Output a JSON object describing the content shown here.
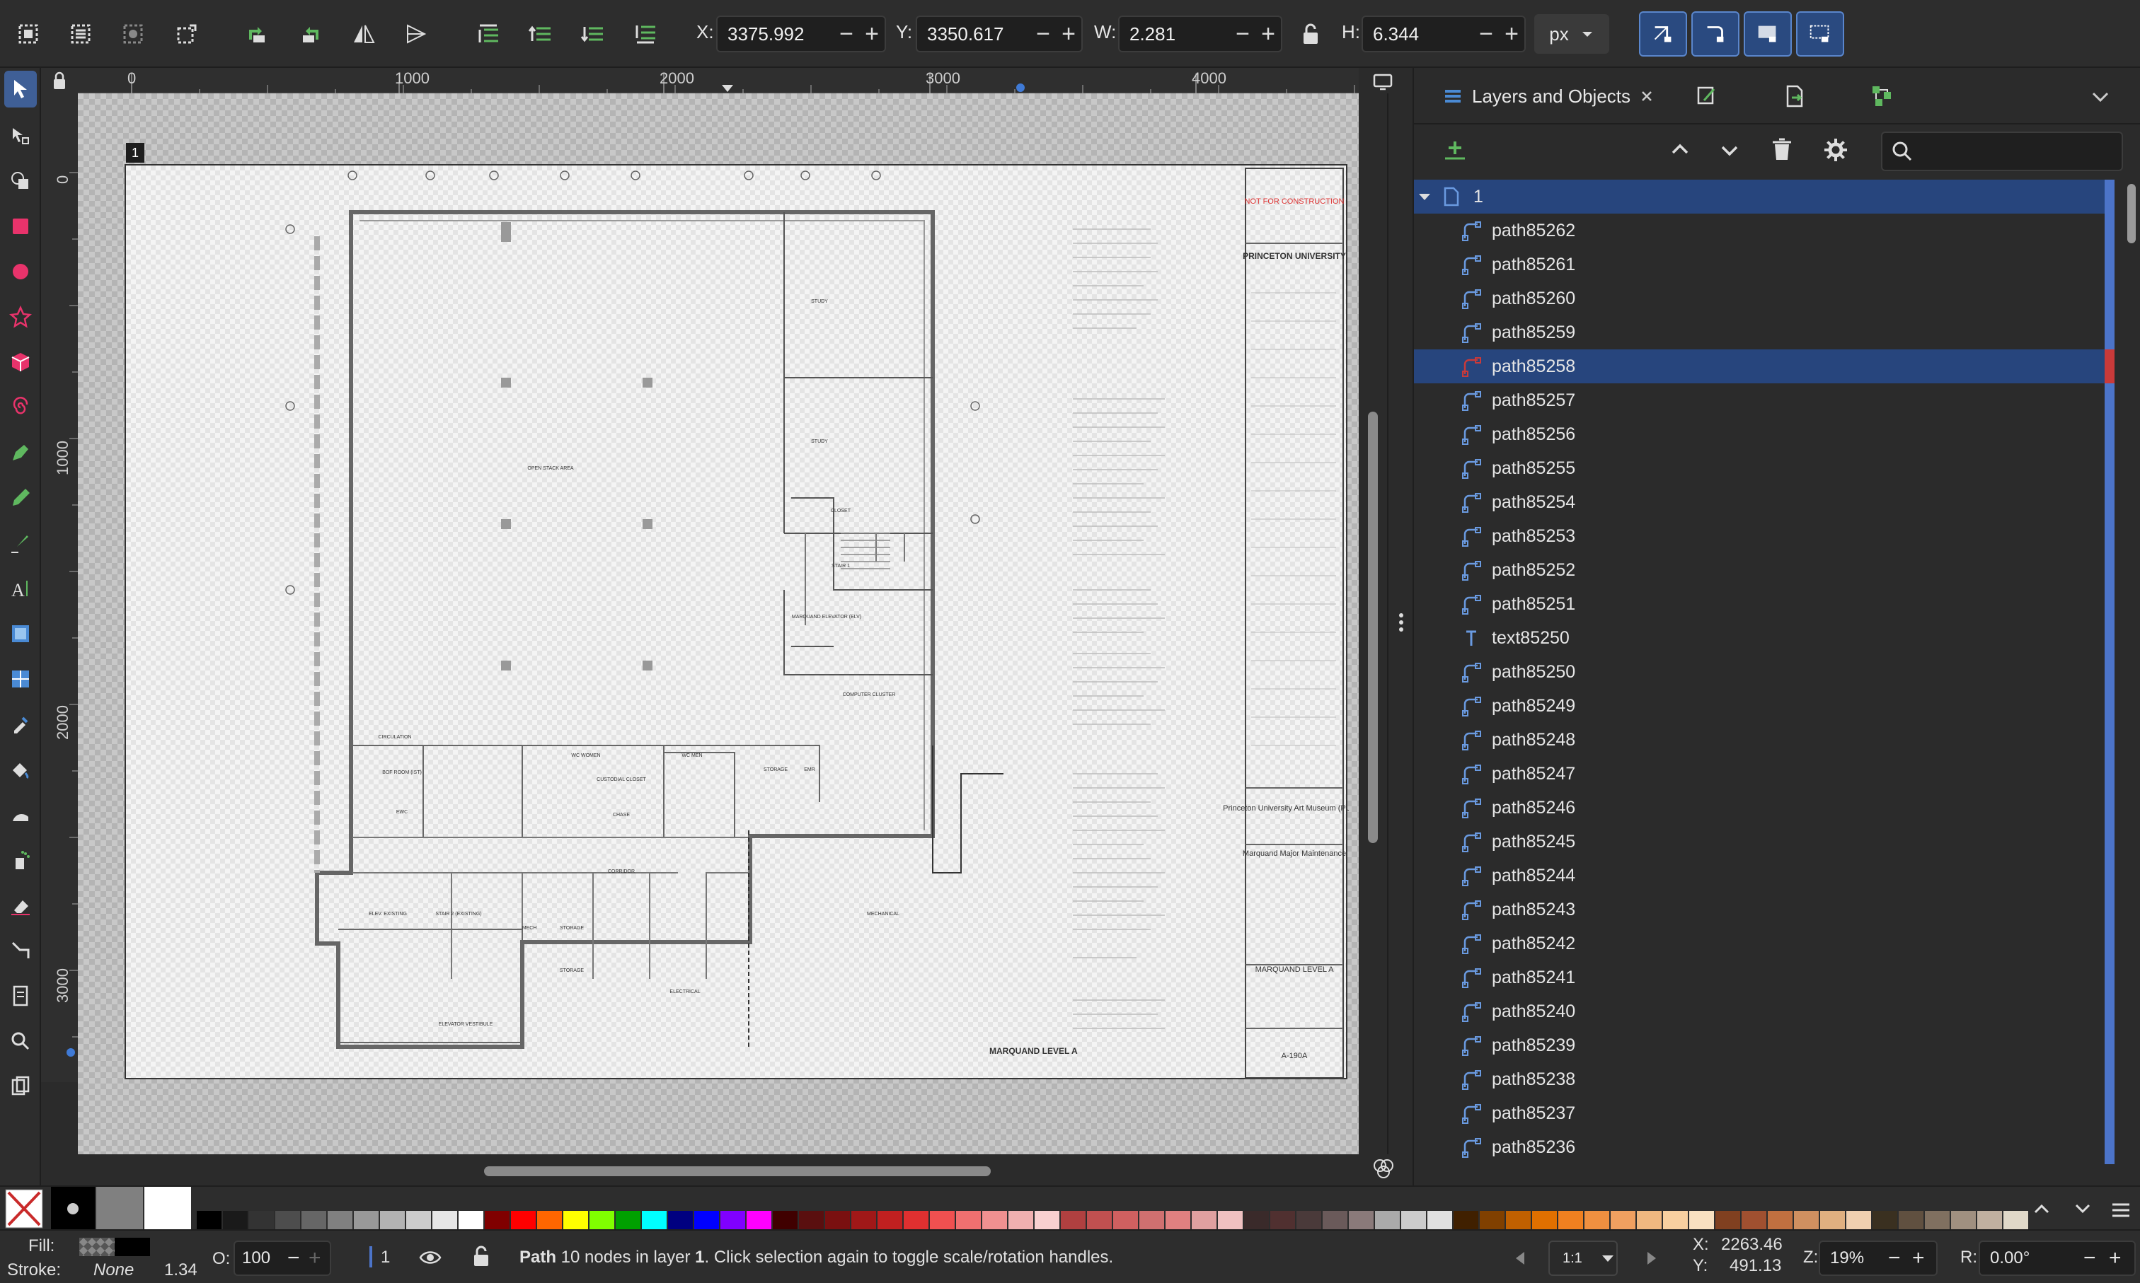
{
  "toolbar": {
    "x_label": "X:",
    "x_value": "3375.992",
    "y_label": "Y:",
    "y_value": "3350.617",
    "w_label": "W:",
    "w_value": "2.281",
    "h_label": "H:",
    "h_value": "6.344",
    "unit": "px",
    "minus": "−",
    "plus": "+"
  },
  "ruler": {
    "h_labels": [
      "0",
      "1000",
      "2000",
      "3000",
      "4000"
    ],
    "v_labels": [
      "0",
      "1000",
      "2000",
      "3000"
    ]
  },
  "canvas": {
    "page_number": "1",
    "drawing": {
      "not_for_construction": "NOT FOR CONSTRUCTION",
      "university": "PRINCETON UNIVERSITY",
      "project": "Princeton University Art Museum (PUAM)",
      "project_sub": "Marquand Major Maintenance",
      "sheet_title": "MARQUAND LEVEL A",
      "sheet_number": "A-190A",
      "plan_title": "MARQUAND LEVEL A",
      "rooms": [
        "OPEN STACK AREA",
        "STUDY",
        "STUDY",
        "CLOSET",
        "STAIR 1",
        "MARQUAND ELEVATOR (ELV)",
        "COMPUTER CLUSTER",
        "CIRCULATION",
        "BOF ROOM (IST)",
        "EWC",
        "WC WOMEN",
        "WC MEN",
        "CUSTODIAL CLOSET",
        "CHASE",
        "STORAGE",
        "EMR",
        "CORRIDOR",
        "MECHANICAL",
        "ELEV. EXISTING",
        "STAIR 2 (EXISTING)",
        "MECH",
        "STORAGE",
        "STORAGE",
        "ELECTRICAL",
        "ELEVATOR VESTIBULE"
      ]
    }
  },
  "panel": {
    "tab_title": "Layers and Objects",
    "root_layer": "1",
    "items": [
      {
        "label": "path85262",
        "type": "path",
        "selected": false
      },
      {
        "label": "path85261",
        "type": "path",
        "selected": false
      },
      {
        "label": "path85260",
        "type": "path",
        "selected": false
      },
      {
        "label": "path85259",
        "type": "path",
        "selected": false
      },
      {
        "label": "path85258",
        "type": "path",
        "selected": true
      },
      {
        "label": "path85257",
        "type": "path",
        "selected": false
      },
      {
        "label": "path85256",
        "type": "path",
        "selected": false
      },
      {
        "label": "path85255",
        "type": "path",
        "selected": false
      },
      {
        "label": "path85254",
        "type": "path",
        "selected": false
      },
      {
        "label": "path85253",
        "type": "path",
        "selected": false
      },
      {
        "label": "path85252",
        "type": "path",
        "selected": false
      },
      {
        "label": "path85251",
        "type": "path",
        "selected": false
      },
      {
        "label": "text85250",
        "type": "text",
        "selected": false
      },
      {
        "label": "path85250",
        "type": "path",
        "selected": false
      },
      {
        "label": "path85249",
        "type": "path",
        "selected": false
      },
      {
        "label": "path85248",
        "type": "path",
        "selected": false
      },
      {
        "label": "path85247",
        "type": "path",
        "selected": false
      },
      {
        "label": "path85246",
        "type": "path",
        "selected": false
      },
      {
        "label": "path85245",
        "type": "path",
        "selected": false
      },
      {
        "label": "path85244",
        "type": "path",
        "selected": false
      },
      {
        "label": "path85243",
        "type": "path",
        "selected": false
      },
      {
        "label": "path85242",
        "type": "path",
        "selected": false
      },
      {
        "label": "path85241",
        "type": "path",
        "selected": false
      },
      {
        "label": "path85240",
        "type": "path",
        "selected": false
      },
      {
        "label": "path85239",
        "type": "path",
        "selected": false
      },
      {
        "label": "path85238",
        "type": "path",
        "selected": false
      },
      {
        "label": "path85237",
        "type": "path",
        "selected": false
      },
      {
        "label": "path85236",
        "type": "path",
        "selected": false
      }
    ]
  },
  "status": {
    "fill_label": "Fill:",
    "stroke_label": "Stroke:",
    "stroke_value": "None",
    "stroke_width": "1.34",
    "opacity_label": "O:",
    "opacity_value": "100",
    "layer_value": "1",
    "message_pre": "Path",
    "message_mid": " 10 nodes in layer ",
    "message_layer": "1",
    "message_post": ". Click selection again to toggle scale/rotation handles.",
    "zoom_preset": "1:1",
    "cursor_x_label": "X:",
    "cursor_x": "2263.46",
    "cursor_y_label": "Y:",
    "cursor_y": "491.13",
    "zoom_label": "Z:",
    "zoom_value": "19%",
    "rotation_label": "R:",
    "rotation_value": "0.00°"
  },
  "colors": {
    "accent": "#3f5f96",
    "selection_row": "#27457d",
    "layer_marker": "#4c74c9",
    "selected_marker": "#c93a3a",
    "palette": [
      "#000000",
      "#1a1a1a",
      "#333333",
      "#4d4d4d",
      "#666666",
      "#808080",
      "#999999",
      "#b3b3b3",
      "#cccccc",
      "#e6e6e6",
      "#ffffff",
      "#800000",
      "#ff0000",
      "#ff6600",
      "#ffff00",
      "#80ff00",
      "#00a000",
      "#00ffff",
      "#000080",
      "#0000ff",
      "#8000ff",
      "#ff00ff",
      "#400000",
      "#5a0f0f",
      "#7a1010",
      "#a01818",
      "#c02020",
      "#e03030",
      "#f05050",
      "#f07070",
      "#f09090",
      "#f0b0b0",
      "#f8d0d0",
      "#b04040",
      "#c05050",
      "#d06060",
      "#d07070",
      "#e08080",
      "#e0a0a0",
      "#f0c0c0",
      "#3a2a2a",
      "#503030",
      "#4a3a3a",
      "#6a5a5a",
      "#8a7a7a",
      "#aaaaaa",
      "#cccccc",
      "#e0e0e0",
      "#402000",
      "#804000",
      "#c06000",
      "#e07000",
      "#f08020",
      "#f09040",
      "#f0a060",
      "#f0b880",
      "#f8d0a0",
      "#f8e0c0",
      "#804020",
      "#a05030",
      "#c07040",
      "#d09060",
      "#e0b080",
      "#f0d0b0",
      "#3a3020",
      "#605040",
      "#807060",
      "#a09080",
      "#c0b0a0",
      "#e0d8c8"
    ]
  }
}
